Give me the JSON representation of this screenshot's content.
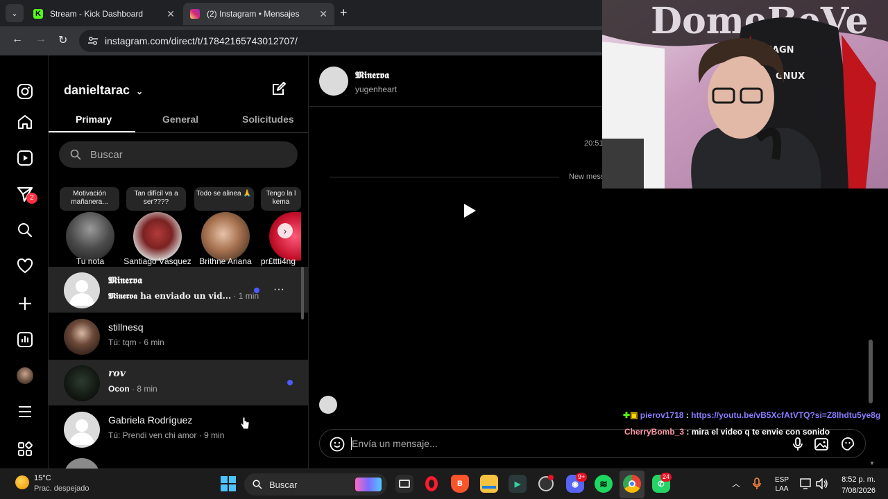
{
  "browser": {
    "tabs": [
      {
        "title": "Stream - Kick Dashboard"
      },
      {
        "title": "(2) Instagram • Mensajes"
      }
    ],
    "url": "instagram.com/direct/t/17842165743012707/"
  },
  "rail": {
    "notifications_badge": "2"
  },
  "inbox": {
    "username": "danieltarac",
    "tabs": {
      "primary": "Primary",
      "general": "General",
      "requests": "Solicitudes"
    },
    "search_placeholder": "Buscar",
    "notes": [
      {
        "text": "Motivación mañanera...",
        "name": "Tu nota"
      },
      {
        "text": "Tan difícil va a ser????",
        "name": "Santiago Vàsquez"
      },
      {
        "text": "Todo se alinea 🙏",
        "name": "Brithne Ariana"
      },
      {
        "text": "Tengo la l kema",
        "name": "pr£ttti4ng"
      }
    ],
    "threads": [
      {
        "name": "𝕸𝖎𝖓𝖊𝖗𝖛𝖆",
        "preview_bold": "𝕸𝖎𝖓𝖊𝖗𝖛𝖆 ha enviado un vid...",
        "time": "· 1 min",
        "unread": true
      },
      {
        "name": "stillnesq",
        "preview": "Tú: tqm",
        "time": "· 6 min",
        "unread": false
      },
      {
        "name": "𝒓𝒐𝒗",
        "preview_bold": "Ocon",
        "time": "· 8 min",
        "unread": true
      },
      {
        "name": "Gabriela Rodríguez",
        "preview": "Tú: Prendi ven chi amor",
        "time": "· 9 min",
        "unread": false
      }
    ]
  },
  "chat": {
    "name": "𝕸𝖎𝖓𝖊𝖗𝖛𝖆",
    "username": "yugenheart",
    "time": "20:51",
    "new_messages": "New mess",
    "composer_placeholder": "Envía un mensaje..."
  },
  "stream_chat": [
    {
      "user": "pierov1718",
      "sep": " : ",
      "text": "https://youtu.be/vB5XcfAtVTQ?si=Z8lhdtu5ye8g",
      "user_color": "#8a7dff",
      "text_color": "#8a7dff"
    },
    {
      "user": "CherryBomb_3",
      "sep": " : ",
      "text": "mira el video q te envie con sonido",
      "user_color": "#ff9aa8",
      "text_color": "#ffffff"
    }
  ],
  "webcam": {
    "chair_text_1": "MAGN",
    "chair_text_2": "GNUX"
  },
  "taskbar": {
    "weather_temp": "15°C",
    "weather_desc": "Prac. despejado",
    "search_placeholder": "Buscar",
    "badge_discord": "9+",
    "badge_whatsapp": "24",
    "lang_1": "ESP",
    "lang_2": "LAA",
    "time": "8:52 p. m.",
    "date": "7/08/2026"
  }
}
